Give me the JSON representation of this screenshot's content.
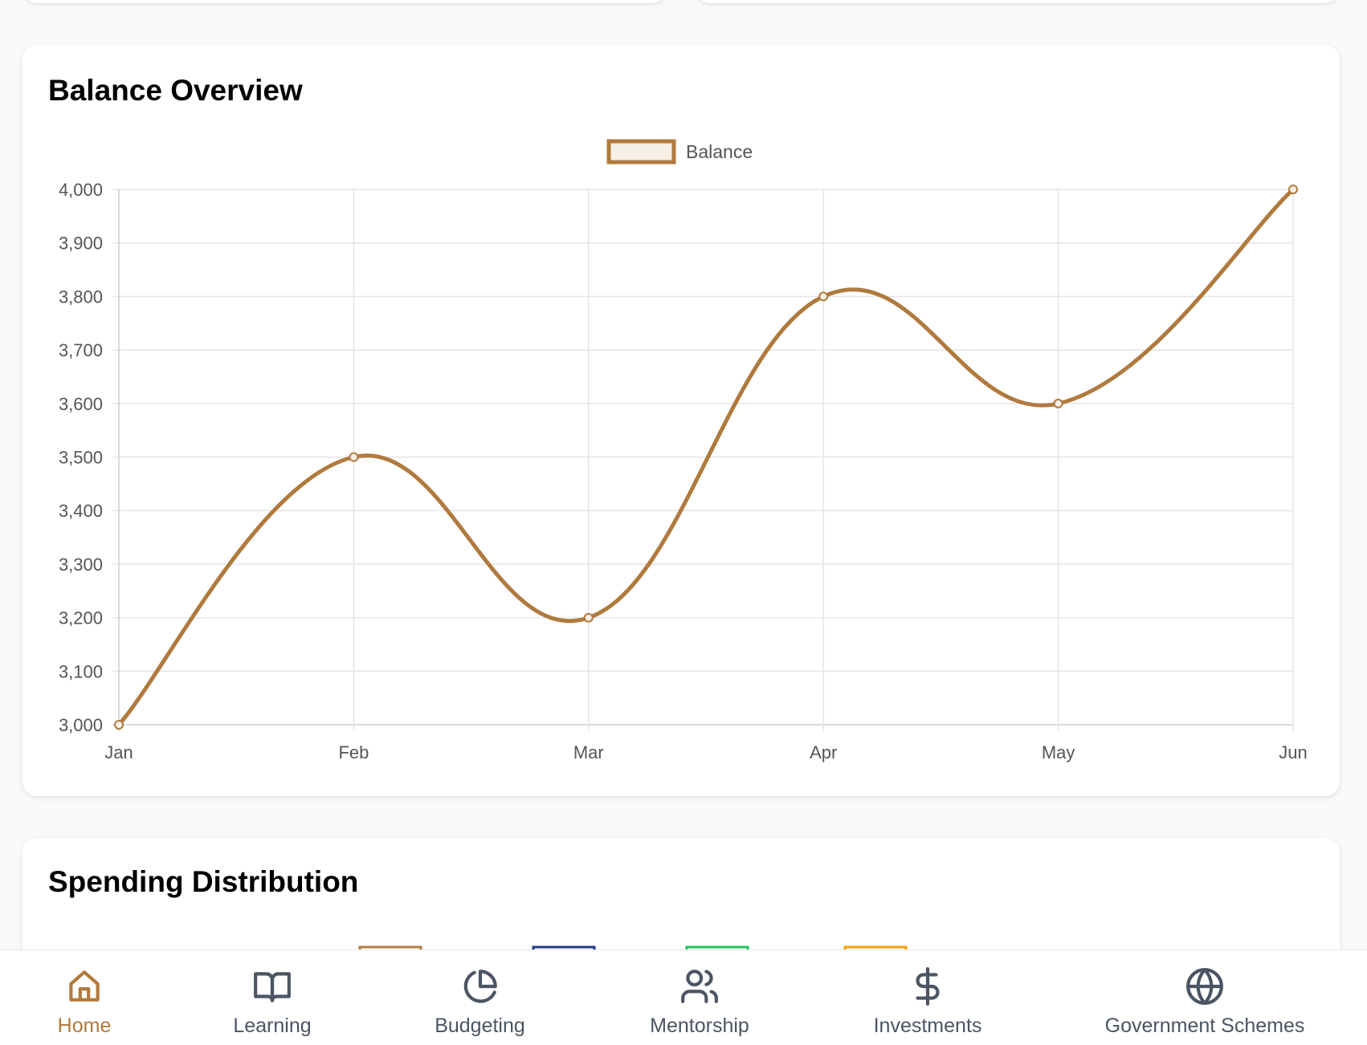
{
  "balance_card": {
    "title": "Balance Overview"
  },
  "spending_card": {
    "title": "Spending Distribution",
    "legend_colors": [
      "#b07a3e",
      "#1e3a8a",
      "#22c55e",
      "#f59e0b"
    ]
  },
  "chart_data": {
    "type": "line",
    "title": "Balance Overview",
    "categories": [
      "Jan",
      "Feb",
      "Mar",
      "Apr",
      "May",
      "Jun"
    ],
    "series": [
      {
        "name": "Balance",
        "values": [
          3000,
          3500,
          3200,
          3800,
          3600,
          4000
        ],
        "color": "#b07a3e"
      }
    ],
    "ylim": [
      3000,
      4000
    ],
    "yticks": [
      "3,000",
      "3,100",
      "3,200",
      "3,300",
      "3,400",
      "3,500",
      "3,600",
      "3,700",
      "3,800",
      "3,900",
      "4,000"
    ],
    "grid": true,
    "legend": "top-center",
    "smooth": true
  },
  "nav": {
    "items": [
      {
        "label": "Home",
        "icon": "home-icon",
        "active": true
      },
      {
        "label": "Learning",
        "icon": "book-icon",
        "active": false
      },
      {
        "label": "Budgeting",
        "icon": "pie-chart-icon",
        "active": false
      },
      {
        "label": "Mentorship",
        "icon": "users-icon",
        "active": false
      },
      {
        "label": "Investments",
        "icon": "dollar-icon",
        "active": false
      },
      {
        "label": "Government Schemes",
        "icon": "globe-icon",
        "active": false
      }
    ],
    "active_color": "#b07a3e",
    "inactive_color": "#4b5563"
  }
}
